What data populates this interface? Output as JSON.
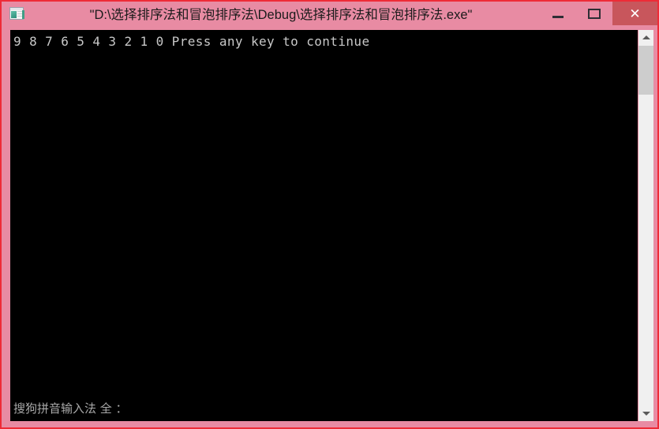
{
  "window": {
    "title": "\"D:\\选择排序法和冒泡排序法\\Debug\\选择排序法和冒泡排序法.exe\"",
    "icon_name": "console-window-icon",
    "frame_color": "#e88ba3",
    "frame_border_color": "#ee2b37",
    "controls": {
      "minimize_label": "",
      "maximize_label": "",
      "close_label": "✕",
      "close_button_color": "#c8565c"
    }
  },
  "console": {
    "background_color": "#000000",
    "text_color": "#c8c8c8",
    "output_line": "9 8 7 6 5 4 3 2 1 0 Press any key to continue",
    "sequence": [
      "9",
      "8",
      "7",
      "6",
      "5",
      "4",
      "3",
      "2",
      "1",
      "0"
    ],
    "prompt": "Press any key to continue",
    "ime_status": "搜狗拼音输入法 全 ："
  },
  "scrollbar": {
    "up_arrow_name": "scroll-up-arrow",
    "down_arrow_name": "scroll-down-arrow",
    "thumb_color": "#cdcdcd",
    "track_color": "#f0f0f0"
  }
}
